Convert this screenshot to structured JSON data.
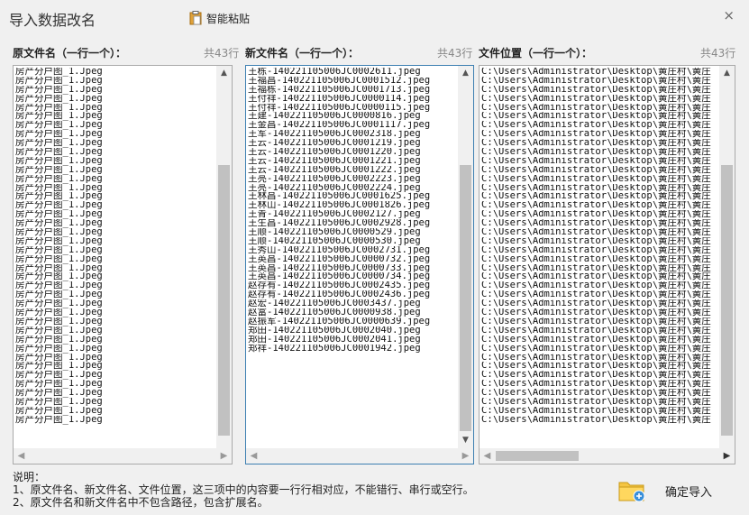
{
  "window": {
    "title": "导入数据改名",
    "paste_label": "智能粘贴",
    "close_glyph": "×"
  },
  "columns": {
    "original": {
      "label": "原文件名（一行一个）：",
      "count": "共43行",
      "lines": [
        "房产分户图_1.Jpeg",
        "房产分户图_1.Jpeg",
        "房产分户图_1.Jpeg",
        "房产分户图_1.Jpeg",
        "房产分户图_1.Jpeg",
        "房产分户图_1.Jpeg",
        "房产分户图_1.Jpeg",
        "房产分户图_1.Jpeg",
        "房产分户图_1.Jpeg",
        "房产分户图_1.Jpeg",
        "房产分户图_1.Jpeg",
        "房产分户图_1.Jpeg",
        "房产分户图_1.Jpeg",
        "房产分户图_1.Jpeg",
        "房产分户图_1.Jpeg",
        "房产分户图_1.Jpeg",
        "房产分户图_1.Jpeg",
        "房产分户图_1.Jpeg",
        "房产分户图_1.Jpeg",
        "房产分户图_1.Jpeg",
        "房产分户图_1.Jpeg",
        "房产分户图_1.Jpeg",
        "房产分户图_1.Jpeg",
        "房产分户图_1.Jpeg",
        "房产分户图_1.Jpeg",
        "房产分户图_1.Jpeg",
        "房产分户图_1.Jpeg",
        "房产分户图_1.Jpeg",
        "房产分户图_1.Jpeg",
        "房产分户图_1.Jpeg",
        "房产分户图_1.Jpeg",
        "房产分户图_1.Jpeg",
        "房产分户图_1.Jpeg",
        "房产分户图_1.Jpeg",
        "房产分户图_1.Jpeg",
        "房产分户图_1.Jpeg",
        "房产分户图_1.Jpeg",
        "房产分户图_1.Jpeg",
        "房产分户图_1.Jpeg",
        "房产分户图_1.Jpeg"
      ]
    },
    "new_name": {
      "label": "新文件名（一行一个）：",
      "count": "共43行",
      "lines": [
        "王栋-140221105006JC0002611.jpeg",
        "王福昌-140221105006JC0001512.jpeg",
        "王福栋-140221105006JC0001713.jpeg",
        "王付祥-140221105006JC0000114.jpeg",
        "王付祥-140221105006JC0000115.jpeg",
        "王建-140221105006JC0000816.jpeg",
        "王金昌-140221105006JC0001117.jpeg",
        "王军-140221105006JC0002318.jpeg",
        "王云-140221105006JC0001219.jpeg",
        "王云-140221105006JC0001220.jpeg",
        "王云-140221105006JC0001221.jpeg",
        "王云-140221105006JC0001222.jpeg",
        "王亮-140221105006JC0002223.jpeg",
        "王亮-140221105006JC0002224.jpeg",
        "王林昌-140221105006JC0001625.jpeg",
        "王林山-140221105006JC0001826.jpeg",
        "王青-140221105006JC0002127.jpeg",
        "王生昌-140221105006JC0002928.jpeg",
        "王顺-140221105006JC0000529.jpeg",
        "王顺-140221105006JC0000530.jpeg",
        "王秀山-140221105006JC0002731.jpeg",
        "王英昌-140221105006JC0000732.jpeg",
        "王英昌-140221105006JC0000733.jpeg",
        "王英昌-140221105006JC0000734.jpeg",
        "赵存有-140221105006JC0002435.jpeg",
        "赵存有-140221105006JC0002436.jpeg",
        "赵宏-140221105006JC0003437.jpeg",
        "赵富-140221105006JC0000938.jpeg",
        "赵振军-140221105006JC0000639.jpeg",
        "郑田-140221105006JC0002040.jpeg",
        "郑田-140221105006JC0002041.jpeg",
        "郑祥-140221105006JC0001942.jpeg"
      ]
    },
    "location": {
      "label": "文件位置（一行一个）：",
      "count": "共43行",
      "lines": [
        "C:\\Users\\Administrator\\Desktop\\黄庄村\\黄庄",
        "C:\\Users\\Administrator\\Desktop\\黄庄村\\黄庄",
        "C:\\Users\\Administrator\\Desktop\\黄庄村\\黄庄",
        "C:\\Users\\Administrator\\Desktop\\黄庄村\\黄庄",
        "C:\\Users\\Administrator\\Desktop\\黄庄村\\黄庄",
        "C:\\Users\\Administrator\\Desktop\\黄庄村\\黄庄",
        "C:\\Users\\Administrator\\Desktop\\黄庄村\\黄庄",
        "C:\\Users\\Administrator\\Desktop\\黄庄村\\黄庄",
        "C:\\Users\\Administrator\\Desktop\\黄庄村\\黄庄",
        "C:\\Users\\Administrator\\Desktop\\黄庄村\\黄庄",
        "C:\\Users\\Administrator\\Desktop\\黄庄村\\黄庄",
        "C:\\Users\\Administrator\\Desktop\\黄庄村\\黄庄",
        "C:\\Users\\Administrator\\Desktop\\黄庄村\\黄庄",
        "C:\\Users\\Administrator\\Desktop\\黄庄村\\黄庄",
        "C:\\Users\\Administrator\\Desktop\\黄庄村\\黄庄",
        "C:\\Users\\Administrator\\Desktop\\黄庄村\\黄庄",
        "C:\\Users\\Administrator\\Desktop\\黄庄村\\黄庄",
        "C:\\Users\\Administrator\\Desktop\\黄庄村\\黄庄",
        "C:\\Users\\Administrator\\Desktop\\黄庄村\\黄庄",
        "C:\\Users\\Administrator\\Desktop\\黄庄村\\黄庄",
        "C:\\Users\\Administrator\\Desktop\\黄庄村\\黄庄",
        "C:\\Users\\Administrator\\Desktop\\黄庄村\\黄庄",
        "C:\\Users\\Administrator\\Desktop\\黄庄村\\黄庄",
        "C:\\Users\\Administrator\\Desktop\\黄庄村\\黄庄",
        "C:\\Users\\Administrator\\Desktop\\黄庄村\\黄庄",
        "C:\\Users\\Administrator\\Desktop\\黄庄村\\黄庄",
        "C:\\Users\\Administrator\\Desktop\\黄庄村\\黄庄",
        "C:\\Users\\Administrator\\Desktop\\黄庄村\\黄庄",
        "C:\\Users\\Administrator\\Desktop\\黄庄村\\黄庄",
        "C:\\Users\\Administrator\\Desktop\\黄庄村\\黄庄",
        "C:\\Users\\Administrator\\Desktop\\黄庄村\\黄庄",
        "C:\\Users\\Administrator\\Desktop\\黄庄村\\黄庄",
        "C:\\Users\\Administrator\\Desktop\\黄庄村\\黄庄",
        "C:\\Users\\Administrator\\Desktop\\黄庄村\\黄庄",
        "C:\\Users\\Administrator\\Desktop\\黄庄村\\黄庄",
        "C:\\Users\\Administrator\\Desktop\\黄庄村\\黄庄",
        "C:\\Users\\Administrator\\Desktop\\黄庄村\\黄庄",
        "C:\\Users\\Administrator\\Desktop\\黄庄村\\黄庄",
        "C:\\Users\\Administrator\\Desktop\\黄庄村\\黄庄",
        "C:\\Users\\Administrator\\Desktop\\黄庄村\\黄庄"
      ]
    }
  },
  "notes": {
    "title": "说明：",
    "line1": "1、原文件名、新文件名、文件位置，这三项中的内容要一行行相对应，不能错行、串行或空行。",
    "line2": "2、原文件名和新文件名中不包含路径，包含扩展名。"
  },
  "import_button": {
    "label": "确定导入"
  },
  "icons": {
    "scroll_up": "▲",
    "scroll_down": "▼",
    "scroll_left": "◀",
    "scroll_right": "▶"
  }
}
